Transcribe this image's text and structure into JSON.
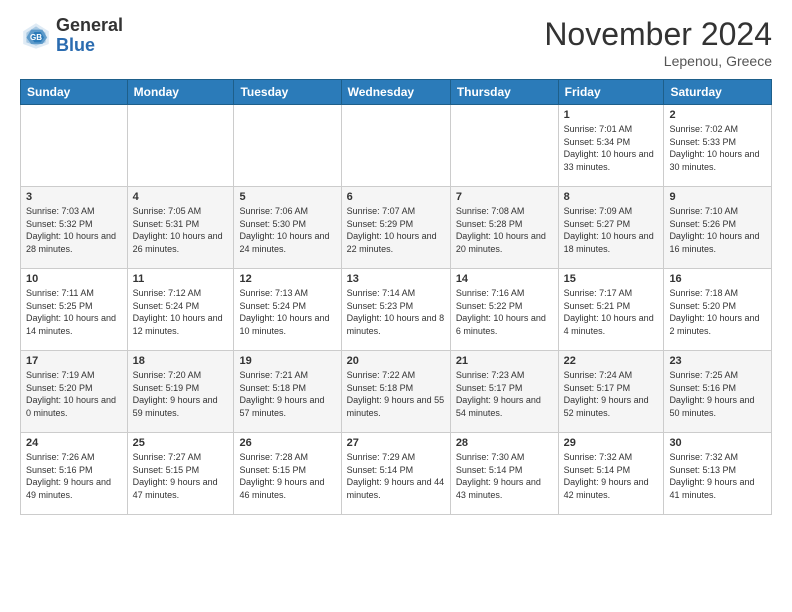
{
  "logo": {
    "general": "General",
    "blue": "Blue"
  },
  "header": {
    "month": "November 2024",
    "location": "Lepenou, Greece"
  },
  "weekdays": [
    "Sunday",
    "Monday",
    "Tuesday",
    "Wednesday",
    "Thursday",
    "Friday",
    "Saturday"
  ],
  "weeks": [
    [
      {
        "day": "",
        "content": ""
      },
      {
        "day": "",
        "content": ""
      },
      {
        "day": "",
        "content": ""
      },
      {
        "day": "",
        "content": ""
      },
      {
        "day": "",
        "content": ""
      },
      {
        "day": "1",
        "content": "Sunrise: 7:01 AM\nSunset: 5:34 PM\nDaylight: 10 hours and 33 minutes."
      },
      {
        "day": "2",
        "content": "Sunrise: 7:02 AM\nSunset: 5:33 PM\nDaylight: 10 hours and 30 minutes."
      }
    ],
    [
      {
        "day": "3",
        "content": "Sunrise: 7:03 AM\nSunset: 5:32 PM\nDaylight: 10 hours and 28 minutes."
      },
      {
        "day": "4",
        "content": "Sunrise: 7:05 AM\nSunset: 5:31 PM\nDaylight: 10 hours and 26 minutes."
      },
      {
        "day": "5",
        "content": "Sunrise: 7:06 AM\nSunset: 5:30 PM\nDaylight: 10 hours and 24 minutes."
      },
      {
        "day": "6",
        "content": "Sunrise: 7:07 AM\nSunset: 5:29 PM\nDaylight: 10 hours and 22 minutes."
      },
      {
        "day": "7",
        "content": "Sunrise: 7:08 AM\nSunset: 5:28 PM\nDaylight: 10 hours and 20 minutes."
      },
      {
        "day": "8",
        "content": "Sunrise: 7:09 AM\nSunset: 5:27 PM\nDaylight: 10 hours and 18 minutes."
      },
      {
        "day": "9",
        "content": "Sunrise: 7:10 AM\nSunset: 5:26 PM\nDaylight: 10 hours and 16 minutes."
      }
    ],
    [
      {
        "day": "10",
        "content": "Sunrise: 7:11 AM\nSunset: 5:25 PM\nDaylight: 10 hours and 14 minutes."
      },
      {
        "day": "11",
        "content": "Sunrise: 7:12 AM\nSunset: 5:24 PM\nDaylight: 10 hours and 12 minutes."
      },
      {
        "day": "12",
        "content": "Sunrise: 7:13 AM\nSunset: 5:24 PM\nDaylight: 10 hours and 10 minutes."
      },
      {
        "day": "13",
        "content": "Sunrise: 7:14 AM\nSunset: 5:23 PM\nDaylight: 10 hours and 8 minutes."
      },
      {
        "day": "14",
        "content": "Sunrise: 7:16 AM\nSunset: 5:22 PM\nDaylight: 10 hours and 6 minutes."
      },
      {
        "day": "15",
        "content": "Sunrise: 7:17 AM\nSunset: 5:21 PM\nDaylight: 10 hours and 4 minutes."
      },
      {
        "day": "16",
        "content": "Sunrise: 7:18 AM\nSunset: 5:20 PM\nDaylight: 10 hours and 2 minutes."
      }
    ],
    [
      {
        "day": "17",
        "content": "Sunrise: 7:19 AM\nSunset: 5:20 PM\nDaylight: 10 hours and 0 minutes."
      },
      {
        "day": "18",
        "content": "Sunrise: 7:20 AM\nSunset: 5:19 PM\nDaylight: 9 hours and 59 minutes."
      },
      {
        "day": "19",
        "content": "Sunrise: 7:21 AM\nSunset: 5:18 PM\nDaylight: 9 hours and 57 minutes."
      },
      {
        "day": "20",
        "content": "Sunrise: 7:22 AM\nSunset: 5:18 PM\nDaylight: 9 hours and 55 minutes."
      },
      {
        "day": "21",
        "content": "Sunrise: 7:23 AM\nSunset: 5:17 PM\nDaylight: 9 hours and 54 minutes."
      },
      {
        "day": "22",
        "content": "Sunrise: 7:24 AM\nSunset: 5:17 PM\nDaylight: 9 hours and 52 minutes."
      },
      {
        "day": "23",
        "content": "Sunrise: 7:25 AM\nSunset: 5:16 PM\nDaylight: 9 hours and 50 minutes."
      }
    ],
    [
      {
        "day": "24",
        "content": "Sunrise: 7:26 AM\nSunset: 5:16 PM\nDaylight: 9 hours and 49 minutes."
      },
      {
        "day": "25",
        "content": "Sunrise: 7:27 AM\nSunset: 5:15 PM\nDaylight: 9 hours and 47 minutes."
      },
      {
        "day": "26",
        "content": "Sunrise: 7:28 AM\nSunset: 5:15 PM\nDaylight: 9 hours and 46 minutes."
      },
      {
        "day": "27",
        "content": "Sunrise: 7:29 AM\nSunset: 5:14 PM\nDaylight: 9 hours and 44 minutes."
      },
      {
        "day": "28",
        "content": "Sunrise: 7:30 AM\nSunset: 5:14 PM\nDaylight: 9 hours and 43 minutes."
      },
      {
        "day": "29",
        "content": "Sunrise: 7:32 AM\nSunset: 5:14 PM\nDaylight: 9 hours and 42 minutes."
      },
      {
        "day": "30",
        "content": "Sunrise: 7:32 AM\nSunset: 5:13 PM\nDaylight: 9 hours and 41 minutes."
      }
    ]
  ]
}
